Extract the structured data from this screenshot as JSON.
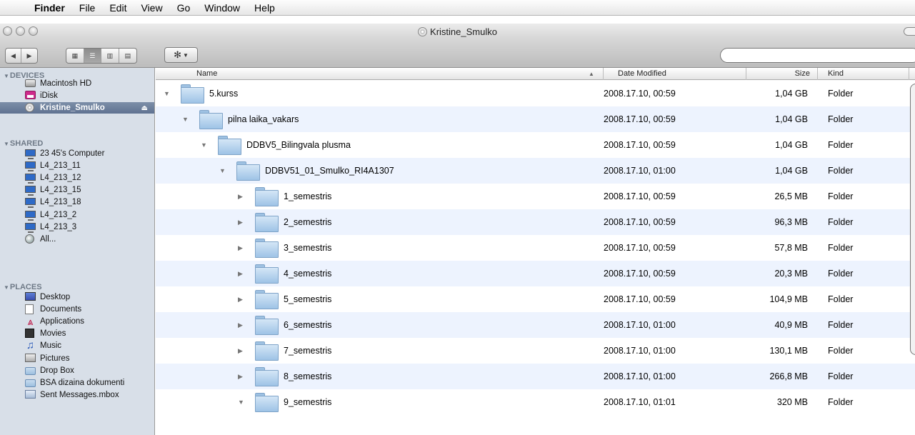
{
  "menubar": {
    "apple_icon": "",
    "app_name": "Finder",
    "items": [
      "File",
      "Edit",
      "View",
      "Go",
      "Window",
      "Help"
    ]
  },
  "window": {
    "title": "Kristine_Smulko"
  },
  "toolbar": {
    "back_icon": "◀",
    "forward_icon": "▶",
    "view_icons": [
      "icon-view",
      "list-view",
      "column-view",
      "coverflow-view"
    ],
    "action_icon": "✻",
    "search_placeholder": ""
  },
  "sidebar": {
    "sections": [
      {
        "title": "DEVICES",
        "items": [
          {
            "label": "Macintosh HD",
            "icon": "hard-disk-icon"
          },
          {
            "label": "iDisk",
            "icon": "idisk-icon"
          },
          {
            "label": "Kristine_Smulko",
            "icon": "cd-disc-icon",
            "selected": true,
            "eject": "⏏"
          }
        ]
      },
      {
        "title": "SHARED",
        "items": [
          {
            "label": "23 45's Computer",
            "icon": "computer-icon"
          },
          {
            "label": "L4_213_11",
            "icon": "computer-icon"
          },
          {
            "label": "L4_213_12",
            "icon": "computer-icon"
          },
          {
            "label": "L4_213_15",
            "icon": "computer-icon"
          },
          {
            "label": "L4_213_18",
            "icon": "computer-icon"
          },
          {
            "label": "L4_213_2",
            "icon": "computer-icon"
          },
          {
            "label": "L4_213_3",
            "icon": "computer-icon"
          },
          {
            "label": "All...",
            "icon": "network-globe-icon"
          }
        ]
      },
      {
        "title": "PLACES",
        "items": [
          {
            "label": "Desktop",
            "icon": "desktop-icon"
          },
          {
            "label": "Documents",
            "icon": "documents-icon"
          },
          {
            "label": "Applications",
            "icon": "applications-icon"
          },
          {
            "label": "Movies",
            "icon": "movies-icon"
          },
          {
            "label": "Music",
            "icon": "music-icon"
          },
          {
            "label": "Pictures",
            "icon": "pictures-icon"
          },
          {
            "label": "Drop Box",
            "icon": "folder-icon"
          },
          {
            "label": "BSA dizaina dokumenti",
            "icon": "folder-icon"
          },
          {
            "label": "Sent Messages.mbox",
            "icon": "mbox-icon"
          }
        ]
      }
    ]
  },
  "columns": {
    "name": "Name",
    "date": "Date Modified",
    "size": "Size",
    "kind": "Kind",
    "sort_indicator": "▲"
  },
  "rows": [
    {
      "name": "5.kurss",
      "date": "2008.17.10, 00:59",
      "size": "1,04 GB",
      "kind": "Folder",
      "expanded": true,
      "depth": 0
    },
    {
      "name": "pilna laika_vakars",
      "date": "2008.17.10, 00:59",
      "size": "1,04 GB",
      "kind": "Folder",
      "expanded": true,
      "depth": 1
    },
    {
      "name": "DDBV5_Bilingvala plusma",
      "date": "2008.17.10, 00:59",
      "size": "1,04 GB",
      "kind": "Folder",
      "expanded": true,
      "depth": 2
    },
    {
      "name": "DDBV51_01_Smulko_RI4A1307",
      "date": "2008.17.10, 01:00",
      "size": "1,04 GB",
      "kind": "Folder",
      "expanded": true,
      "depth": 3
    },
    {
      "name": "1_semestris",
      "date": "2008.17.10, 00:59",
      "size": "26,5 MB",
      "kind": "Folder",
      "expanded": false,
      "depth": 4
    },
    {
      "name": "2_semestris",
      "date": "2008.17.10, 00:59",
      "size": "96,3 MB",
      "kind": "Folder",
      "expanded": false,
      "depth": 4
    },
    {
      "name": "3_semestris",
      "date": "2008.17.10, 00:59",
      "size": "57,8 MB",
      "kind": "Folder",
      "expanded": false,
      "depth": 4
    },
    {
      "name": "4_semestris",
      "date": "2008.17.10, 00:59",
      "size": "20,3 MB",
      "kind": "Folder",
      "expanded": false,
      "depth": 4
    },
    {
      "name": "5_semestris",
      "date": "2008.17.10, 00:59",
      "size": "104,9 MB",
      "kind": "Folder",
      "expanded": false,
      "depth": 4
    },
    {
      "name": "6_semestris",
      "date": "2008.17.10, 01:00",
      "size": "40,9 MB",
      "kind": "Folder",
      "expanded": false,
      "depth": 4
    },
    {
      "name": "7_semestris",
      "date": "2008.17.10, 01:00",
      "size": "130,1 MB",
      "kind": "Folder",
      "expanded": false,
      "depth": 4
    },
    {
      "name": "8_semestris",
      "date": "2008.17.10, 01:00",
      "size": "266,8 MB",
      "kind": "Folder",
      "expanded": false,
      "depth": 4
    },
    {
      "name": "9_semestris",
      "date": "2008.17.10, 01:01",
      "size": "320 MB",
      "kind": "Folder",
      "expanded": true,
      "depth": 4
    }
  ]
}
